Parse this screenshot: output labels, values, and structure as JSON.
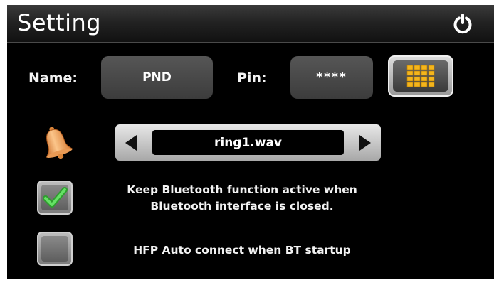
{
  "window": {
    "title": "Setting",
    "power_icon": "power-icon"
  },
  "device": {
    "name_label": "Name:",
    "name_value": "PND",
    "pin_label": "Pin:",
    "pin_value": "****",
    "keypad_icon": "keypad-icon"
  },
  "ringtone": {
    "icon": "bell-icon",
    "value": "ring1.wav",
    "prev_icon": "arrow-left-icon",
    "next_icon": "arrow-right-icon"
  },
  "options": [
    {
      "line1": "Keep Bluetooth function active when",
      "line2": "Bluetooth interface is closed.",
      "checked": true
    },
    {
      "line1": "HFP Auto connect when BT startup",
      "checked": false
    }
  ],
  "colors": {
    "check": "#3cc83c",
    "keypad": "#f4b51c",
    "bell": "#f0a050"
  }
}
